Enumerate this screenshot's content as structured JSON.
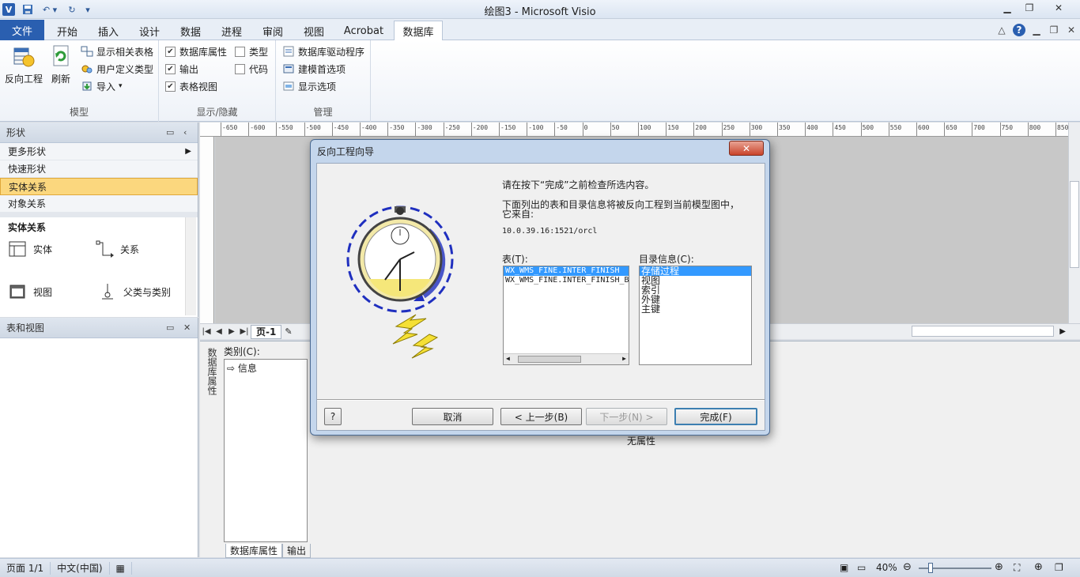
{
  "window": {
    "title": "绘图3 - Microsoft Visio",
    "logo_letter": "V"
  },
  "tabs": [
    "文件",
    "开始",
    "插入",
    "设计",
    "数据",
    "进程",
    "审阅",
    "视图",
    "Acrobat",
    "数据库"
  ],
  "ribbon": {
    "model_group": {
      "label": "模型",
      "reverse_engineer": "反向工程",
      "refresh": "刷新",
      "show_related_tables": "显示相关表格",
      "user_defined_types": "用户定义类型",
      "import": "导入"
    },
    "show_hide_group": {
      "label": "显示/隐藏",
      "db_properties": "数据库属性",
      "output": "输出",
      "table_view": "表格视图",
      "type": "类型",
      "code": "代码"
    },
    "manage_group": {
      "label": "管理",
      "db_drivers": "数据库驱动程序",
      "modeling_prefs": "建模首选项",
      "display_options": "显示选项"
    }
  },
  "shapes_pane": {
    "title": "形状",
    "categories": [
      "更多形状",
      "快速形状",
      "实体关系",
      "对象关系"
    ],
    "stencil_title": "实体关系",
    "items": [
      "实体",
      "关系",
      "视图",
      "父类与类别"
    ]
  },
  "tables_pane": {
    "title": "表和视图"
  },
  "ruler_ticks": [
    "-650",
    "-600",
    "-550",
    "-500",
    "-450",
    "-400",
    "-350",
    "-300",
    "-250",
    "-200",
    "-150",
    "-100",
    "-50",
    "0",
    "50",
    "100",
    "150",
    "200",
    "250",
    "300",
    "350",
    "400",
    "450",
    "500",
    "550",
    "600",
    "650",
    "700",
    "750",
    "800",
    "850"
  ],
  "page_tab": "页-1",
  "db_properties": {
    "vertical_label": "数据库属性",
    "category_label": "类别(C):",
    "category_item": "信息",
    "no_properties": "无属性",
    "tabs": [
      "数据库属性",
      "输出"
    ]
  },
  "status": {
    "page": "页面 1/1",
    "language": "中文(中国)",
    "zoom": "40%"
  },
  "dialog": {
    "title": "反向工程向导",
    "line1": "请在按下“完成”之前检查所选内容。",
    "line2a": "下面列出的表和目录信息将被反向工程到当前模型图中，",
    "line2b": "它来自:",
    "source": "10.0.39.16:1521/orcl",
    "tables_label": "表(T):",
    "tables": [
      "WX_WMS_FINE.INTER_FINISH",
      "WX_WMS_FINE.INTER_FINISH_B"
    ],
    "catalog_label": "目录信息(C):",
    "catalog": [
      "存储过程",
      "视图",
      "索引",
      "外键",
      "主键"
    ],
    "buttons": {
      "cancel": "取消",
      "back": "< 上一步(B)",
      "next": "下一步(N) >",
      "finish": "完成(F)"
    },
    "help_icon": "?"
  },
  "colors": {
    "file_tab": "#2a5fb0",
    "selection": "#3399ff",
    "active_category": "#fbd77e"
  }
}
